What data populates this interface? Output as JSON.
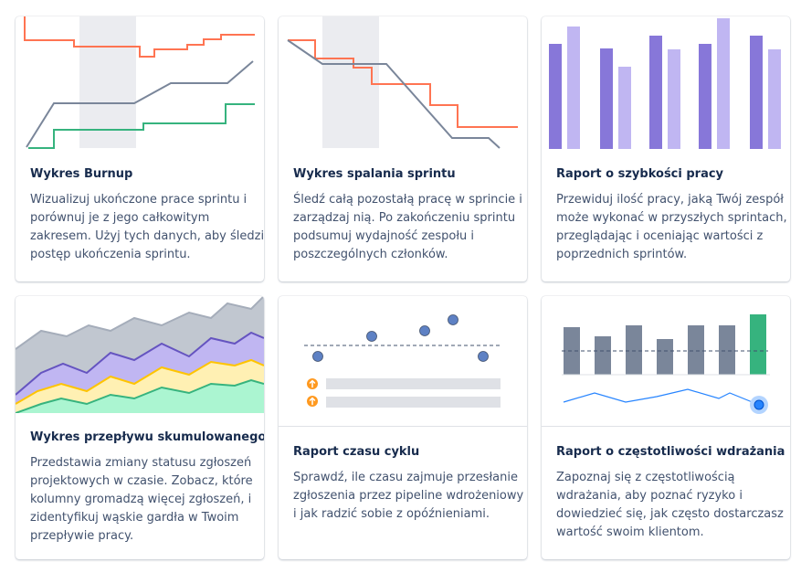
{
  "colors": {
    "orange": "#ff7452",
    "gray_line": "#7a869a",
    "green": "#36b37e",
    "purple": "#8777d9",
    "purple_light": "#c0b6f2",
    "yellow": "#ffc400",
    "blue_dot": "#5e81c4",
    "alert_orange": "#ff991f"
  },
  "cards": [
    {
      "title": "Wykres Burnup",
      "desc": [
        "Wizualizuj ukończone prace sprintu i",
        "porównuj je z jego całkowitym",
        "zakresem. Użyj tych danych, aby śledzić",
        "postęp ukończenia sprintu."
      ]
    },
    {
      "title": "Wykres spalania sprintu",
      "desc": [
        "Śledź całą pozostałą pracę w sprincie i",
        "zarządzaj nią. Po zakończeniu sprintu",
        "podsumuj wydajność zespołu i",
        "poszczególnych członków."
      ]
    },
    {
      "title": "Raport o szybkości pracy",
      "desc": [
        "Przewiduj ilość pracy, jaką Twój zespół",
        "może wykonać w przyszłych sprintach,",
        "przeglądając i oceniając wartości z",
        "poprzednich sprintów."
      ]
    },
    {
      "title": "Wykres przepływu skumulowanego",
      "desc": [
        "Przedstawia zmiany statusu zgłoszeń",
        "projektowych w czasie. Zobacz, które",
        "kolumny gromadzą więcej zgłoszeń, i",
        "zidentyfikuj wąskie gardła w Twoim",
        "przepływie pracy."
      ]
    },
    {
      "title": "Raport czasu cyklu",
      "desc": [
        "Sprawdź, ile czasu zajmuje przesłanie",
        "zgłoszenia przez pipeline wdrożeniowy",
        "i jak radzić sobie z opóźnieniami."
      ]
    },
    {
      "title": "Raport o częstotliwości wdrażania",
      "desc": [
        "Zapoznaj się z częstotliwością",
        "wdrażania, aby poznać ryzyko i",
        "dowiedzieć się, jak często dostarczasz",
        "wartość swoim klientom."
      ]
    }
  ]
}
